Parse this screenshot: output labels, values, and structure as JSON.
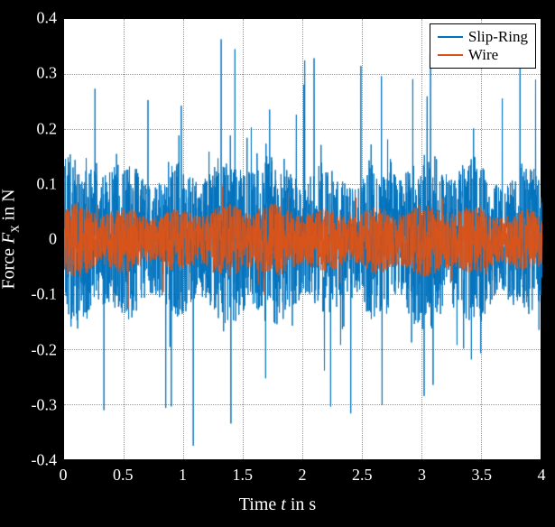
{
  "chart_data": {
    "type": "line",
    "title": "",
    "xlabel": "Time t in s",
    "ylabel": "Force Fₓ in N",
    "xlim": [
      0,
      4
    ],
    "ylim": [
      -0.4,
      0.4
    ],
    "xticks": [
      0,
      0.5,
      1,
      1.5,
      2,
      2.5,
      3,
      3.5,
      4
    ],
    "yticks": [
      -0.4,
      -0.3,
      -0.2,
      -0.1,
      0,
      0.1,
      0.2,
      0.3,
      0.4
    ],
    "legend_position": "top-right",
    "grid": true,
    "series": [
      {
        "name": "Slip-Ring",
        "color": "#0072BD",
        "note": "dense noisy force signal, approx range -0.4 to 0.35 N, mean ~0",
        "envelope_amplitude": 0.22,
        "noise_character": "spiky, occasional peaks to ±0.4"
      },
      {
        "name": "Wire",
        "color": "#D95319",
        "note": "dense noisy force signal, approx range -0.13 to 0.13 N, mean ~0",
        "envelope_amplitude": 0.09,
        "noise_character": "tighter band than Slip-Ring"
      }
    ]
  }
}
